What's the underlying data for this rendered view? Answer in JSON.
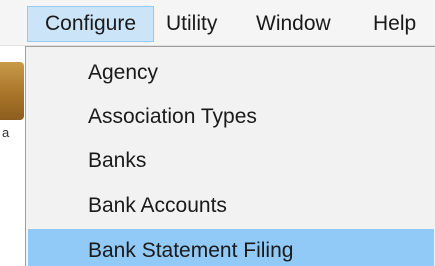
{
  "menubar": {
    "items": [
      {
        "label": "Configure",
        "active": true
      },
      {
        "label": "Utility"
      },
      {
        "label": "Window"
      },
      {
        "label": "Help"
      }
    ]
  },
  "background_app": {
    "icon": "app-icon",
    "cut_text": "a"
  },
  "configure_menu": {
    "items": [
      {
        "label": "Agency"
      },
      {
        "label": "Association Types"
      },
      {
        "label": "Banks"
      },
      {
        "label": "Bank Accounts"
      },
      {
        "label": "Bank Statement Filing",
        "highlighted": true
      }
    ]
  },
  "colors": {
    "highlight": "#91c9f7",
    "active_menubar": "#cce4f7",
    "menu_background": "#f2f2f2"
  }
}
